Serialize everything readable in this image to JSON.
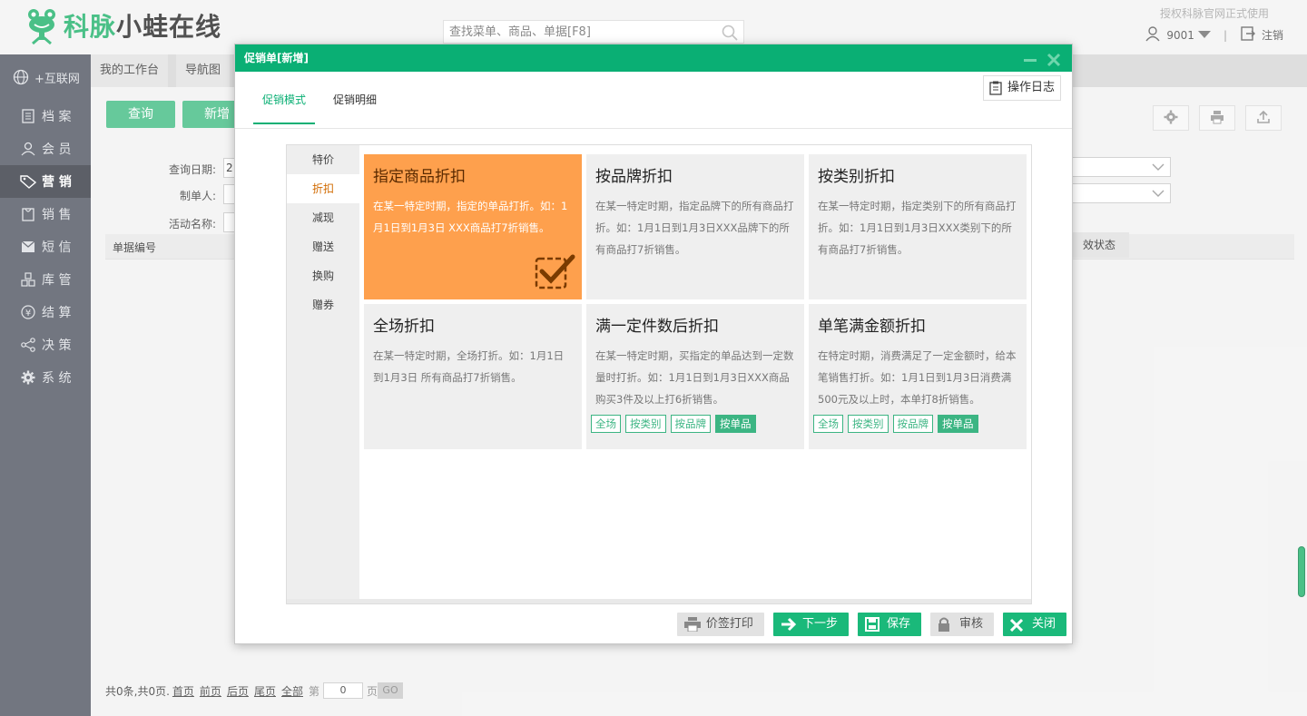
{
  "header": {
    "brand_green": "科脉",
    "brand_dark": "小蛙在线",
    "search_placeholder": "查找菜单、商品、单据[F8]",
    "auth_note": "授权科脉官网正式使用",
    "user": "9001",
    "logout": "注销"
  },
  "sidebar": {
    "items": [
      {
        "label": "+互联网",
        "icon": "globe-icon"
      },
      {
        "label": "档 案",
        "icon": "file-icon"
      },
      {
        "label": "会 员",
        "icon": "user-icon"
      },
      {
        "label": "营 销",
        "icon": "tag-icon"
      },
      {
        "label": "销 售",
        "icon": "cart-icon"
      },
      {
        "label": "短 信",
        "icon": "mail-icon"
      },
      {
        "label": "库 管",
        "icon": "boxes-icon"
      },
      {
        "label": "结 算",
        "icon": "yen-icon"
      },
      {
        "label": "决 策",
        "icon": "share-icon"
      },
      {
        "label": "系 统",
        "icon": "gear-icon"
      }
    ],
    "active_index": 3
  },
  "bg": {
    "tabs": [
      "我的工作台",
      "导航图"
    ],
    "query_btn": "查询",
    "add_btn": "新增",
    "query_date_label": "查询日期:",
    "query_date_value": "2",
    "creator_label": "制单人:",
    "activity_label": "活动名称:",
    "col_doc_no": "单据编号",
    "col_status": "效状态",
    "pager": {
      "summary": "共0条,共0页.",
      "first": "首页",
      "prev": "前页",
      "next": "后页",
      "last": "尾页",
      "all": "全部",
      "page_prefix": "第",
      "page_value": "0",
      "page_suffix": "页",
      "go": "GO"
    }
  },
  "modal": {
    "title": "促销单[新增]",
    "tabs": [
      "促销模式",
      "促销明细"
    ],
    "log_btn": "操作日志",
    "vtabs": [
      "特价",
      "折扣",
      "减现",
      "赠送",
      "换购",
      "赠券"
    ],
    "active_vtab": 1,
    "cards": [
      {
        "title": "指定商品折扣",
        "desc": "在某一特定时期，指定的单品打折。如：1月1日到1月3日 XXX商品打7折销售。",
        "selected": true
      },
      {
        "title": "按品牌折扣",
        "desc": "在某一特定时期，指定品牌下的所有商品打折。如：1月1日到1月3日XXX品牌下的所有商品打7折销售。"
      },
      {
        "title": "按类别折扣",
        "desc": "在某一特定时期，指定类别下的所有商品打折。如：1月1日到1月3日XXX类别下的所有商品打7折销售。"
      },
      {
        "title": "全场折扣",
        "desc": "在某一特定时期，全场打折。如：1月1日到1月3日 所有商品打7折销售。"
      },
      {
        "title": "满一定件数后折扣",
        "desc": "在某一特定时期，买指定的单品达到一定数量时打折。如：1月1日到1月3日XXX商品购买3件及以上打6折销售。",
        "tags": [
          "全场",
          "按类别",
          "按品牌",
          "按单品"
        ]
      },
      {
        "title": "单笔满金额折扣",
        "desc": "在特定时期，消费满足了一定金额时，给本笔销售打折。如：1月1日到1月3日消费满500元及以上时，本单打8折销售。",
        "tags": [
          "全场",
          "按类别",
          "按品牌",
          "按单品"
        ]
      }
    ],
    "footer": {
      "print": "价签打印",
      "next": "下一步",
      "save": "保存",
      "audit": "审核",
      "close": "关闭"
    }
  },
  "colors": {
    "brand": "#0aaf74",
    "selected_card": "#fea04d",
    "sidebar": "#5a5f6a"
  }
}
